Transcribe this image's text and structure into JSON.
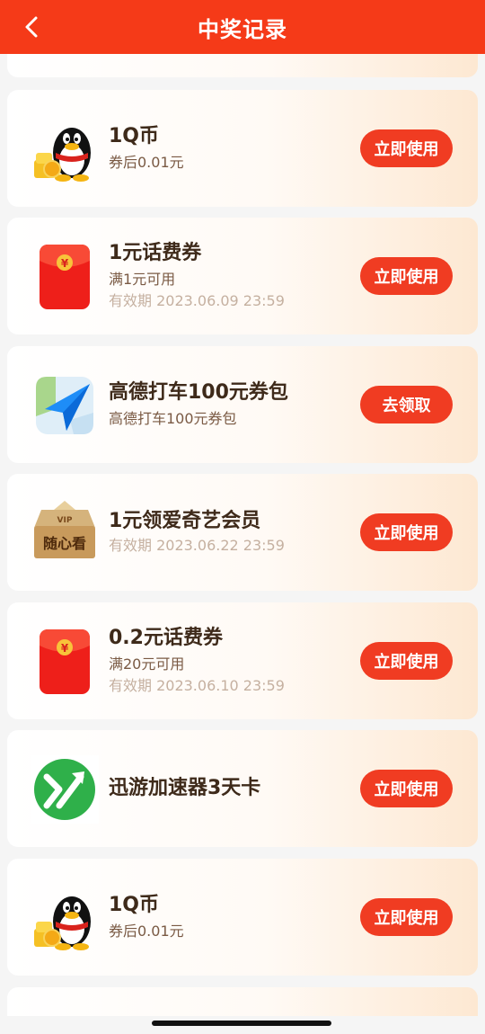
{
  "header": {
    "title": "中奖记录",
    "back_icon": "chevron-left-icon"
  },
  "prizes": [
    {
      "icon": "qq-penguin-icon",
      "name": "1Q币",
      "sub": "券后0.01元",
      "expiry": "",
      "action": "立即使用"
    },
    {
      "icon": "red-envelope-icon",
      "name": "1元话费券",
      "sub": "满1元可用",
      "expiry": "有效期 2023.06.09 23:59",
      "action": "立即使用"
    },
    {
      "icon": "amap-icon",
      "name": "高德打车100元券包",
      "sub": "高德打车100元券包",
      "expiry": "",
      "action": "去领取"
    },
    {
      "icon": "iqiyi-vip-box-icon",
      "name": "1元领爱奇艺会员",
      "sub": "",
      "expiry": "有效期 2023.06.22 23:59",
      "action": "立即使用",
      "icon_text_top": "VIP",
      "icon_text_main": "随心看"
    },
    {
      "icon": "red-envelope-icon",
      "name": "0.2元话费券",
      "sub": "满20元可用",
      "expiry": "有效期 2023.06.10 23:59",
      "action": "立即使用"
    },
    {
      "icon": "xunyou-icon",
      "name": "迅游加速器3天卡",
      "sub": "",
      "expiry": "",
      "action": "立即使用"
    },
    {
      "icon": "qq-penguin-icon",
      "name": "1Q币",
      "sub": "券后0.01元",
      "expiry": "",
      "action": "立即使用"
    }
  ],
  "colors": {
    "header": "#f53a18",
    "button": "#f03c22",
    "title_text": "#3e2a1a"
  }
}
